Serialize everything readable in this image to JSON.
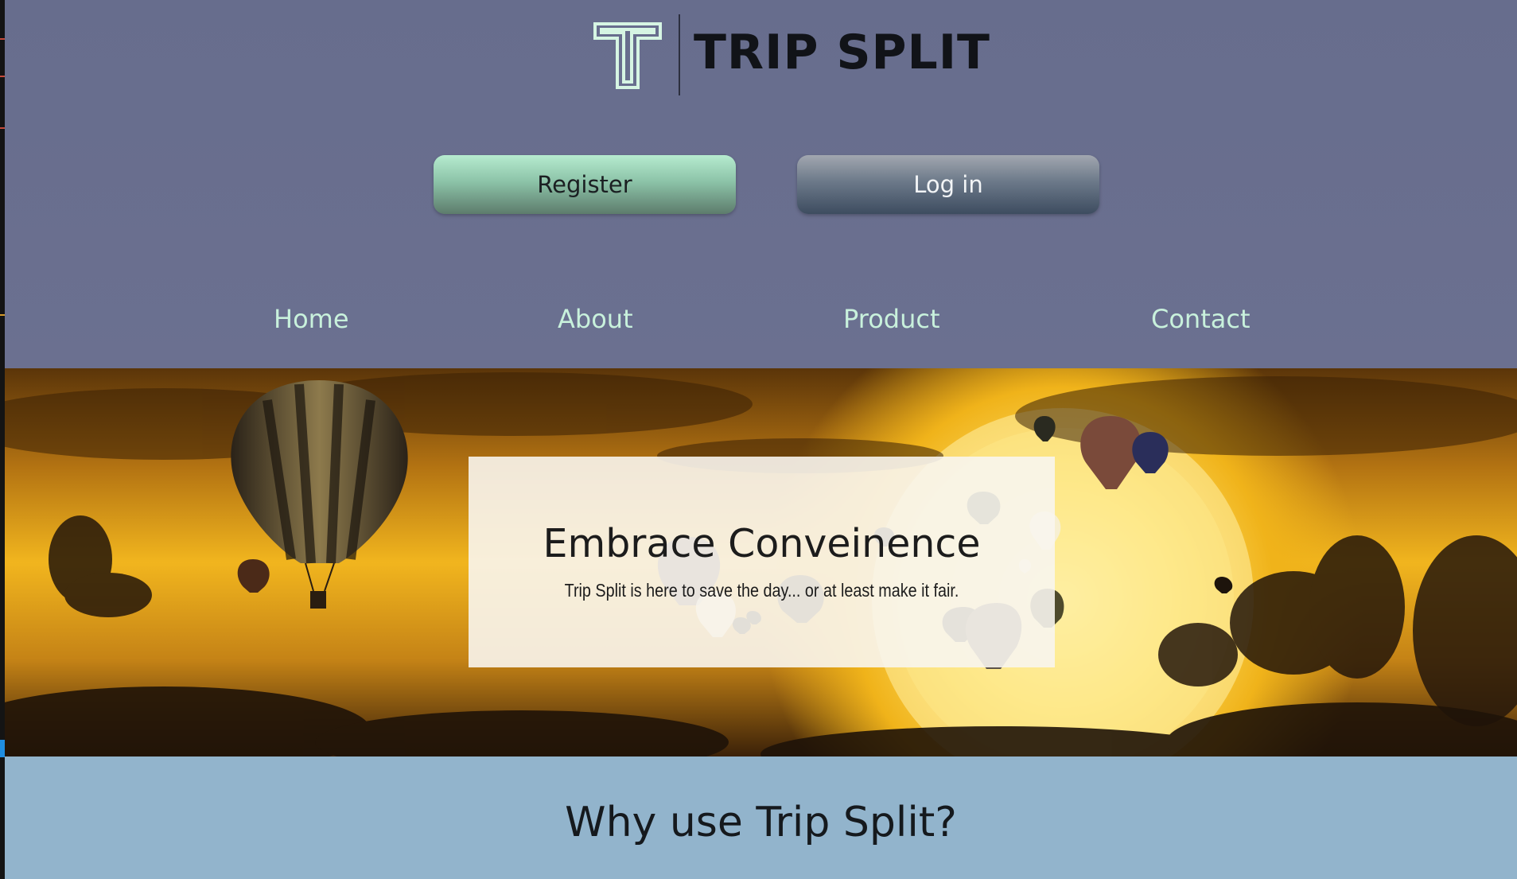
{
  "brand": {
    "name": "TRIP SPLIT",
    "logo_icon": "trip-split-t-logo-icon",
    "logo_color": "#d6f5e3"
  },
  "auth": {
    "register_label": "Register",
    "login_label": "Log in"
  },
  "nav": {
    "items": [
      {
        "label": "Home"
      },
      {
        "label": "About"
      },
      {
        "label": "Product"
      },
      {
        "label": "Contact"
      }
    ],
    "color": "#c8f1dc"
  },
  "hero": {
    "title": "Embrace Conveinence",
    "subtitle": "Trip Split is here to save the day... or at least make it fair."
  },
  "why": {
    "title": "Why use Trip Split?"
  },
  "colors": {
    "header_bg": "#6b7090",
    "why_bg": "#92b4cc",
    "register_bg": "#8cc3a8",
    "login_bg": "#56667a"
  }
}
